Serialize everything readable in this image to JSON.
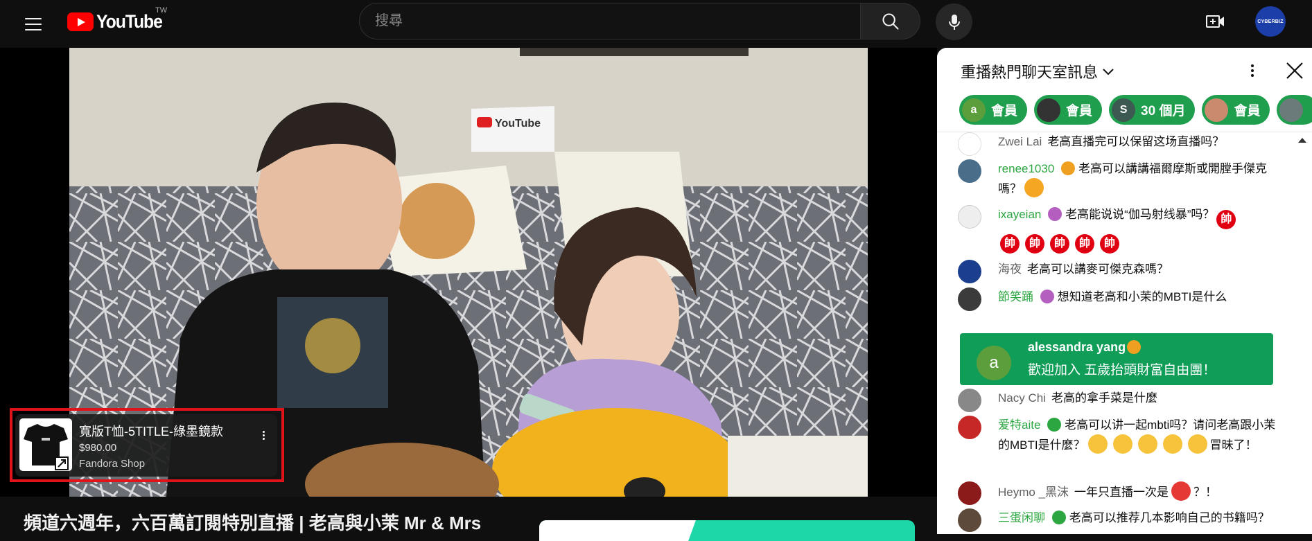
{
  "masthead": {
    "logo_text": "YouTube",
    "region": "TW",
    "search_placeholder": "搜尋",
    "avatar_text": "CYBERBIZ",
    "icons": [
      "menu-icon",
      "search-icon",
      "mic-icon",
      "create-video-icon"
    ]
  },
  "player": {
    "pillow_text": "YouTube",
    "product": {
      "title": "寬版T恤-5TITLE-綠墨鏡款",
      "price": "$980.00",
      "shop": "Fandora Shop"
    }
  },
  "video": {
    "title": "頻道六週年，六百萬訂閱特別直播 | 老高與小茉 Mr & Mrs"
  },
  "chat": {
    "title": "重播熱門聊天室訊息",
    "chips": [
      {
        "avatar": "a",
        "label": "會員",
        "color": "#5c9e3c"
      },
      {
        "avatar": "",
        "label": "會員",
        "color": "#333333"
      },
      {
        "avatar": "S",
        "label": "30 個月",
        "color": "#3d5a52"
      },
      {
        "avatar": "",
        "label": "會員",
        "color": "#c98a6e"
      },
      {
        "avatar": "",
        "label": "",
        "color": "#6a7b7a"
      }
    ],
    "messages": [
      {
        "author": "Zwei Lai",
        "text": "老高直播完可以保留这场直播吗？"
      },
      {
        "author": "renee1030",
        "text1": "老高可以講講福爾摩斯或開膛手傑克嗎？"
      },
      {
        "author": "ixayeian",
        "text1": "老高能说说“伽马射线暴”吗？",
        "emoji_label": "帥"
      },
      {
        "author": "海夜",
        "text": "老高可以講麥可傑克森嗎？"
      },
      {
        "author": "節笑踊",
        "text": "想知道老高和小茉的MBTI是什么"
      },
      {
        "author": "Nacy Chi",
        "text": "老高的拿手菜是什麼"
      },
      {
        "author": "爱特aite",
        "text1": "老高可以讲一起mbti吗？请问老高跟小茉的MBTI是什麼？",
        "text2": "冒昧了！"
      },
      {
        "author": "Heymo _黑沫",
        "text1": "一年只直播一次是",
        "text2": "？！"
      },
      {
        "author": "三蛋闲聊",
        "text": "老高可以推荐几本影响自己的书籍吗？"
      }
    ],
    "join": {
      "avatar": "a",
      "name": "alessandra yang",
      "text": "歡迎加入 五歲抬頭財富自由團！"
    }
  },
  "colors": {
    "brand_red": "#ff0000",
    "member_green": "#2ba640",
    "chip_green": "#1f9e4d",
    "join_green": "#0f9d58",
    "highlight_red": "#e1131a"
  }
}
